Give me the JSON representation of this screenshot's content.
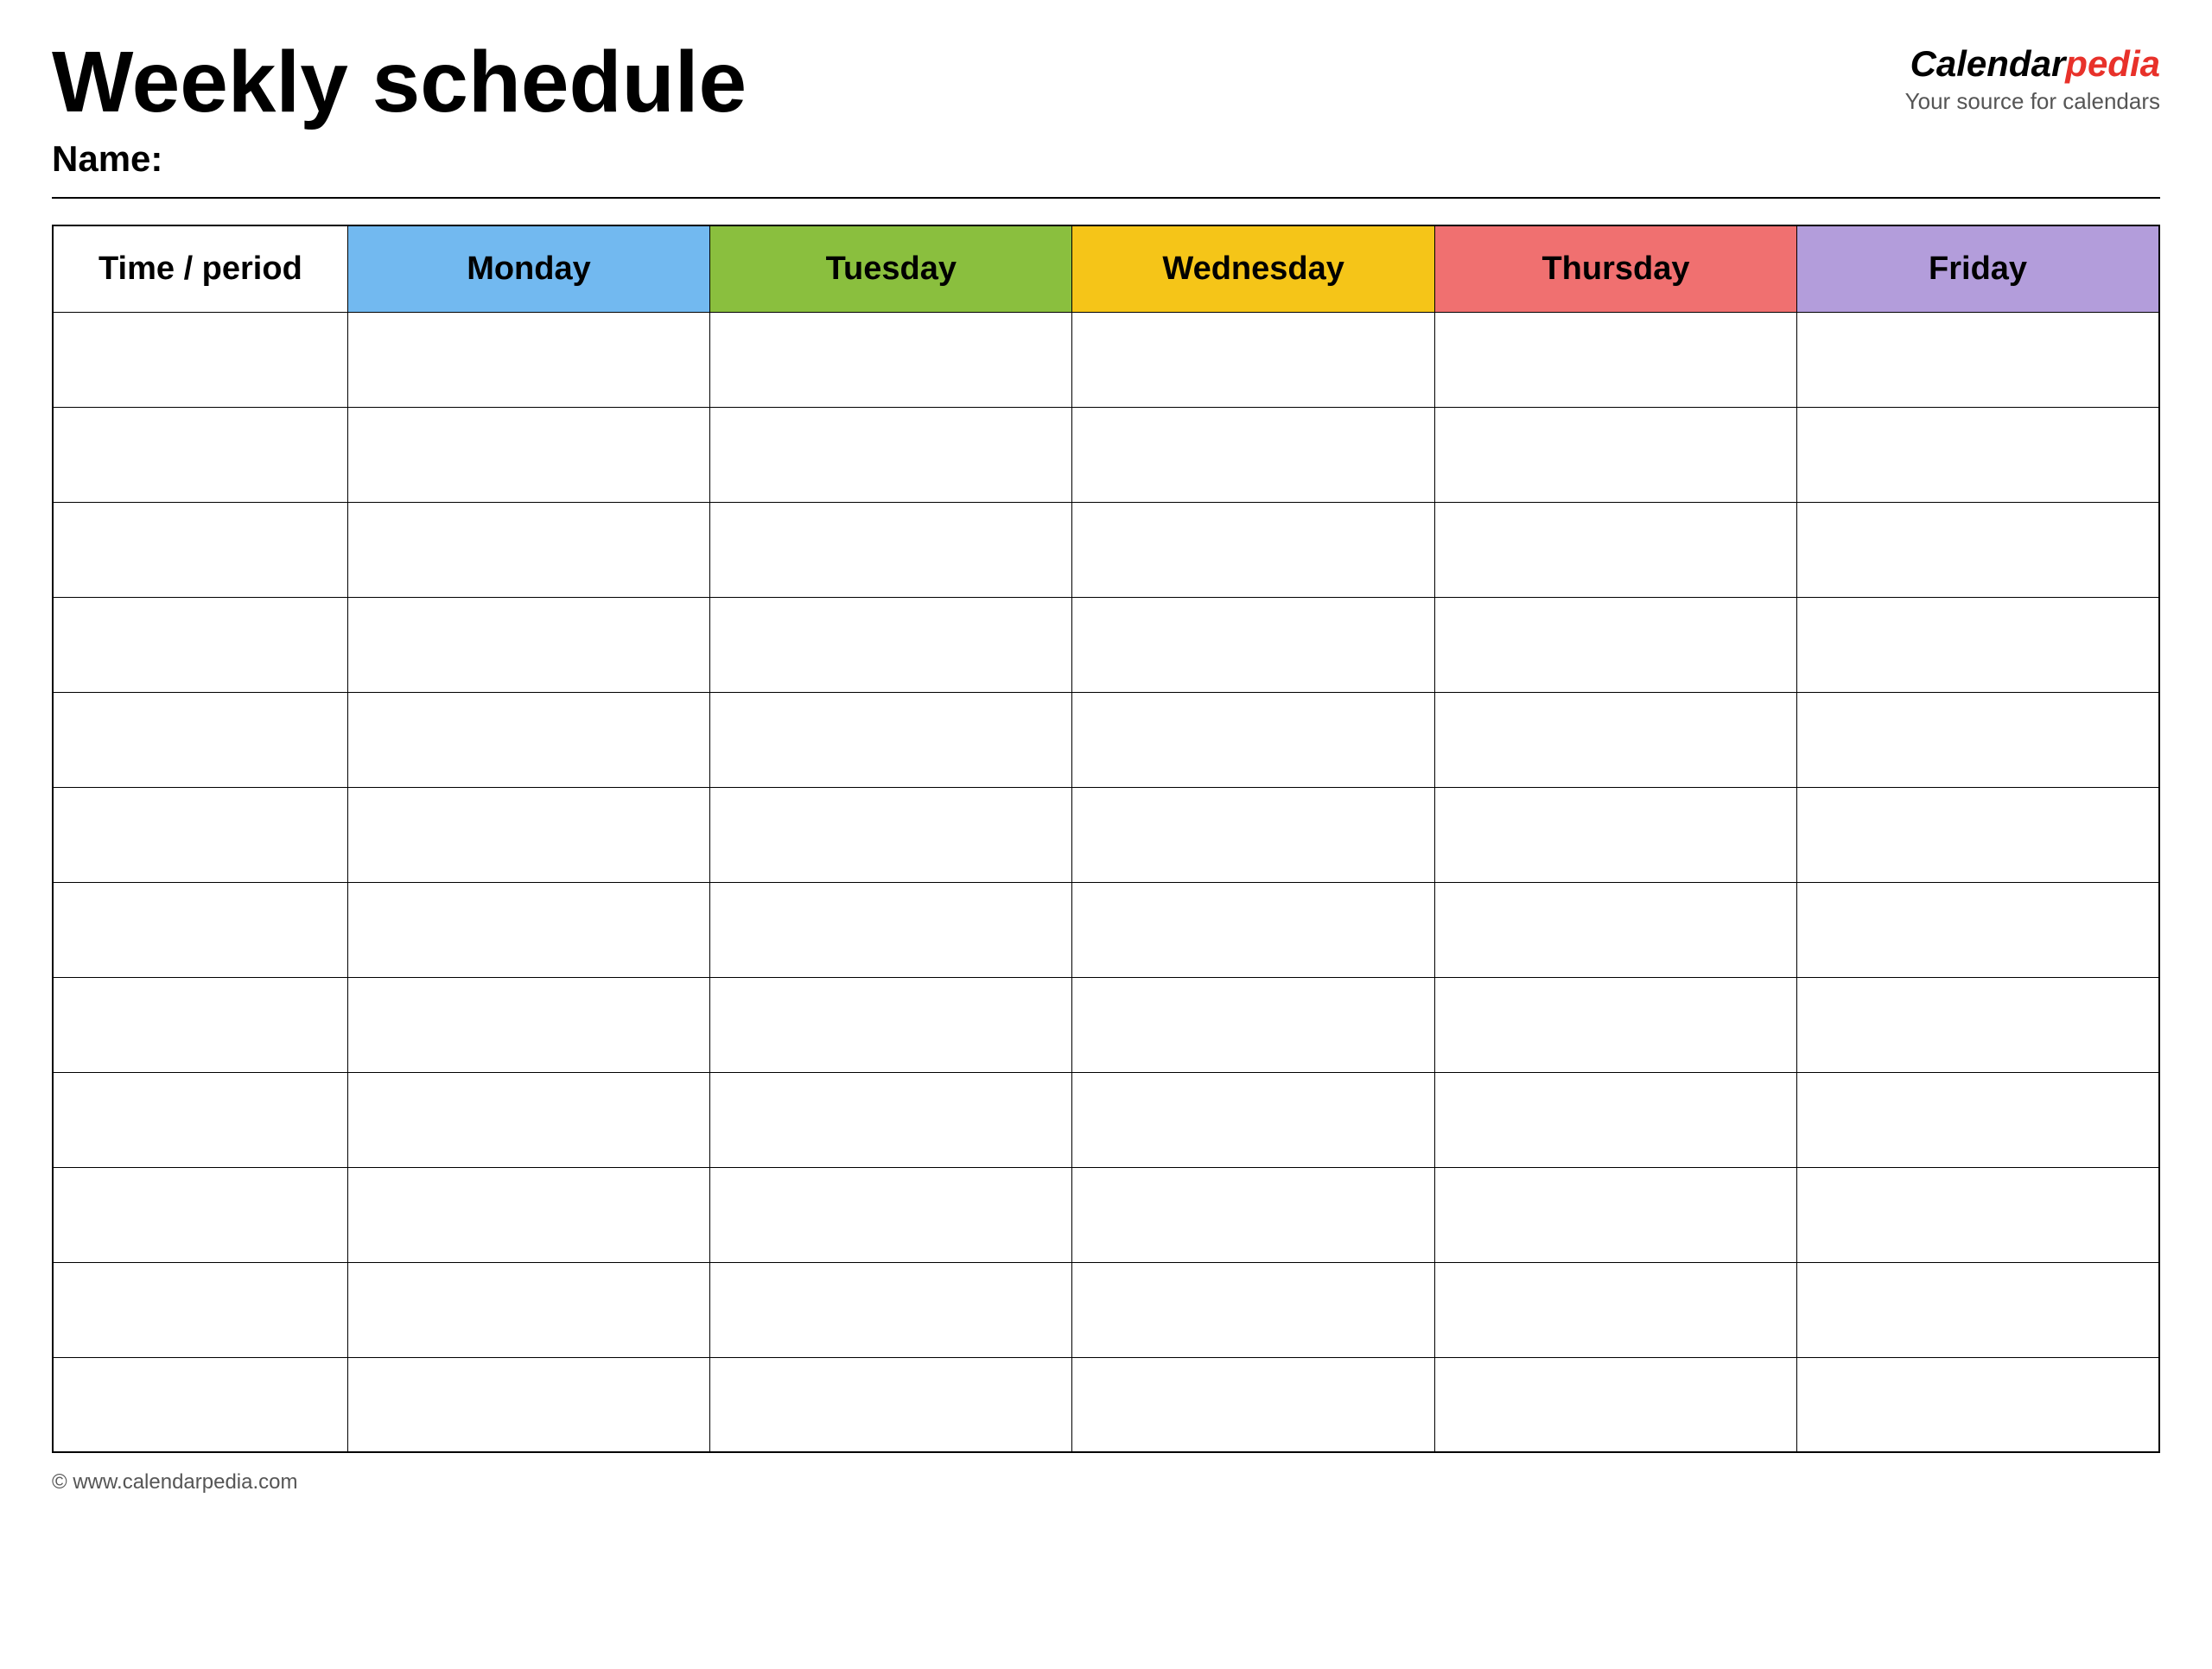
{
  "header": {
    "main_title": "Weekly schedule",
    "name_label": "Name:",
    "logo": {
      "calendar_text": "Calendar",
      "pedia_text": "pedia",
      "tagline": "Your source for calendars"
    }
  },
  "table": {
    "columns": [
      {
        "key": "time",
        "label": "Time / period",
        "class": "col-time"
      },
      {
        "key": "monday",
        "label": "Monday",
        "class": "col-monday"
      },
      {
        "key": "tuesday",
        "label": "Tuesday",
        "class": "col-tuesday"
      },
      {
        "key": "wednesday",
        "label": "Wednesday",
        "class": "col-wednesday"
      },
      {
        "key": "thursday",
        "label": "Thursday",
        "class": "col-thursday"
      },
      {
        "key": "friday",
        "label": "Friday",
        "class": "col-friday"
      }
    ],
    "row_count": 12
  },
  "footer": {
    "url": "© www.calendarpedia.com"
  }
}
